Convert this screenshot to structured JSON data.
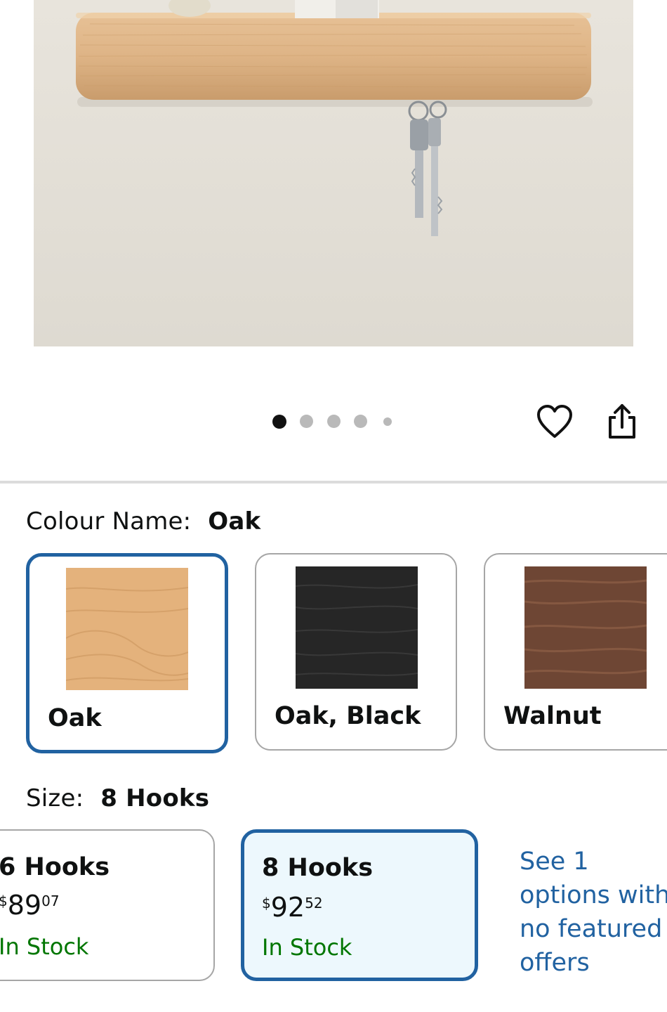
{
  "gallery": {
    "image_alt": "Wooden wall shelf with hooks holding keys",
    "dot_count": 5,
    "active_dot": 0
  },
  "actions": {
    "wishlist_icon": "heart-outline-icon",
    "share_icon": "share-icon"
  },
  "colour": {
    "label": "Colour Name:",
    "selected": "Oak",
    "options": [
      {
        "name": "Oak",
        "selected": true,
        "swatch_color": "#e4b27c"
      },
      {
        "name": "Oak, Black",
        "selected": false,
        "swatch_color": "#262626"
      },
      {
        "name": "Walnut",
        "selected": false,
        "swatch_color": "#6e4634"
      }
    ]
  },
  "size": {
    "label": "Size:",
    "selected": "8 Hooks",
    "options": [
      {
        "name": "6 Hooks",
        "currency": "$",
        "whole": "89",
        "fraction": "07",
        "stock": "In Stock",
        "selected": false
      },
      {
        "name": "8 Hooks",
        "currency": "$",
        "whole": "92",
        "fraction": "52",
        "stock": "In Stock",
        "selected": true
      }
    ],
    "see_more": "See 1 options with no featured offers"
  },
  "colors": {
    "accent": "#2162a1",
    "in_stock": "#007600",
    "selected_bg": "#edf8fd"
  }
}
